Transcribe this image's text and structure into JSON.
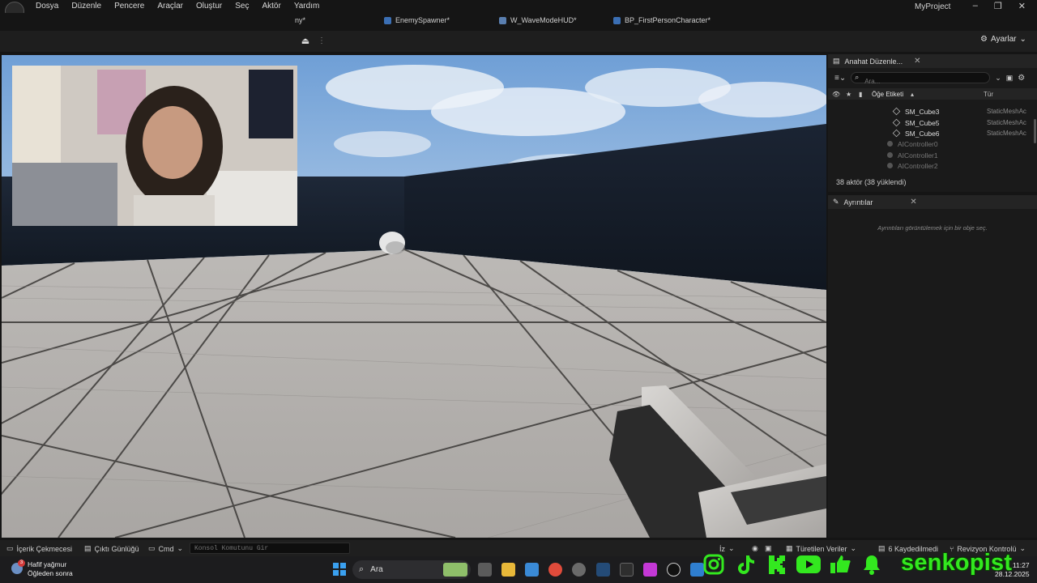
{
  "app": {
    "project_name": "MyProject",
    "menu": [
      "Dosya",
      "Düzenle",
      "Pencere",
      "Araçlar",
      "Oluştur",
      "Seç",
      "Aktör",
      "Yardım"
    ]
  },
  "tabs": [
    {
      "label": "ny*"
    },
    {
      "label": "EnemySpawner*"
    },
    {
      "label": "W_WaveModeHUD*"
    },
    {
      "label": "BP_FirstPersonCharacter*"
    }
  ],
  "toolbar": {
    "settings_label": "Ayarlar"
  },
  "outliner": {
    "title": "Anahat Düzenle...",
    "search_placeholder": "Ara...",
    "col_label": "Öğe Etiketi",
    "col_type": "Tür",
    "rows": [
      {
        "name": "SM_Cube3",
        "type": "StaticMeshAc"
      },
      {
        "name": "SM_Cube5",
        "type": "StaticMeshAc"
      },
      {
        "name": "SM_Cube6",
        "type": "StaticMeshAc"
      },
      {
        "name": "AIController0",
        "type": ""
      },
      {
        "name": "AIController1",
        "type": ""
      },
      {
        "name": "AIController2",
        "type": ""
      }
    ],
    "actor_count": "38 aktör (38 yüklendi)"
  },
  "details": {
    "title": "Ayrıntılar",
    "hint": "Ayrıntıları görüntülemek için bir obje seç."
  },
  "statusbar": {
    "content_drawer": "İçerik Çekmecesi",
    "output_log": "Çıktı Günlüğü",
    "cmd": "Cmd",
    "console_placeholder": "Konsol Komutunu Gir",
    "iz": "İz",
    "derived_data": "Türetilen Veriler",
    "unsaved": "6 Kaydedilmedi",
    "revision": "Revizyon Kontrolü"
  },
  "taskbar": {
    "weather_line1": "Hafif yağmur",
    "weather_line2": "Öğleden sonra",
    "weather_badge": "3",
    "search_label": "Ara",
    "time": "11:27",
    "date": "28.12.2025"
  },
  "overlay": {
    "streamer_name": "senkopist"
  }
}
